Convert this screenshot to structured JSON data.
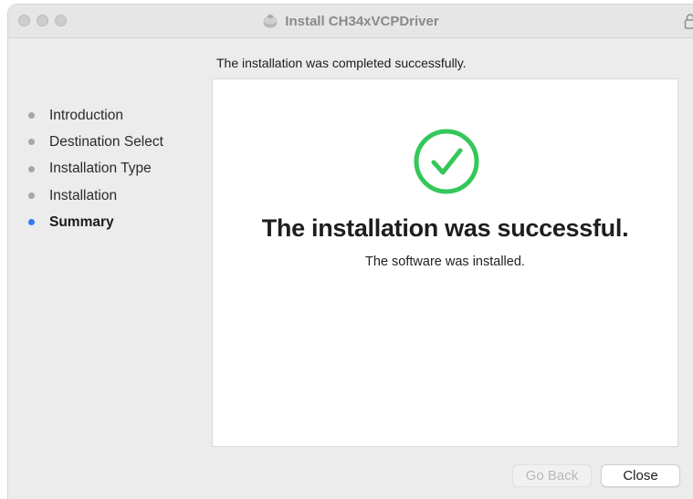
{
  "window": {
    "title": "Install CH34xVCPDriver",
    "title_icon": "package-icon",
    "lock_icon": "lock-icon"
  },
  "header": {
    "status_text": "The installation was completed successfully."
  },
  "steps": [
    {
      "label": "Introduction",
      "active": false
    },
    {
      "label": "Destination Select",
      "active": false
    },
    {
      "label": "Installation Type",
      "active": false
    },
    {
      "label": "Installation",
      "active": false
    },
    {
      "label": "Summary",
      "active": true
    }
  ],
  "result": {
    "title": "The installation was successful.",
    "subtitle": "The software was installed.",
    "icon": "checkmark-circle-icon"
  },
  "buttons": {
    "back_label": "Go Back",
    "close_label": "Close"
  },
  "colors": {
    "accent": "#3478f6",
    "success": "#34c759",
    "inactive_dot": "#a6a6a6"
  }
}
